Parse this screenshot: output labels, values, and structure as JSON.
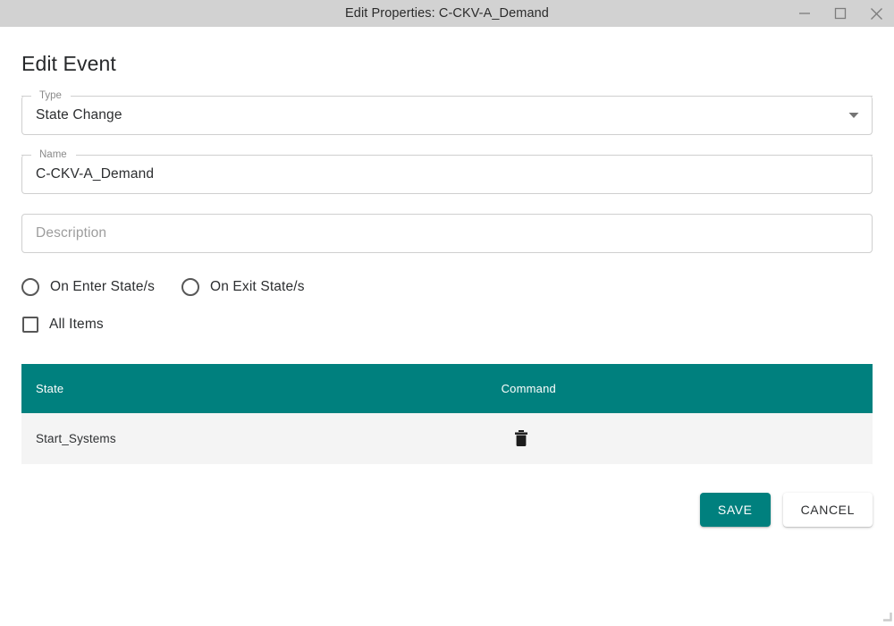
{
  "window": {
    "title": "Edit Properties: C-CKV-A_Demand",
    "controls": {
      "minimize": "minimize-icon",
      "maximize": "maximize-icon",
      "close": "close-icon"
    }
  },
  "page": {
    "heading": "Edit Event"
  },
  "form": {
    "type": {
      "label": "Type",
      "value": "State Change",
      "icon": "chevron-down-icon"
    },
    "name": {
      "label": "Name",
      "value": "C-CKV-A_Demand"
    },
    "description": {
      "label": "Description",
      "value": "",
      "placeholder": "Description"
    },
    "radios": [
      {
        "label": "On Enter State/s",
        "selected": false
      },
      {
        "label": "On Exit State/s",
        "selected": false
      }
    ],
    "checkbox": {
      "label": "All Items",
      "checked": false
    }
  },
  "table": {
    "columns": [
      "State",
      "Command"
    ],
    "rows": [
      {
        "state": "Start_Systems",
        "command_icon": "trash-icon"
      }
    ]
  },
  "actions": {
    "save_label": "SAVE",
    "cancel_label": "CANCEL"
  },
  "colors": {
    "accent": "#00807e",
    "titlebar": "#d2d2d2",
    "row_background": "#f4f4f4",
    "field_border": "#cfcfcf",
    "text": "#2c2e30"
  }
}
